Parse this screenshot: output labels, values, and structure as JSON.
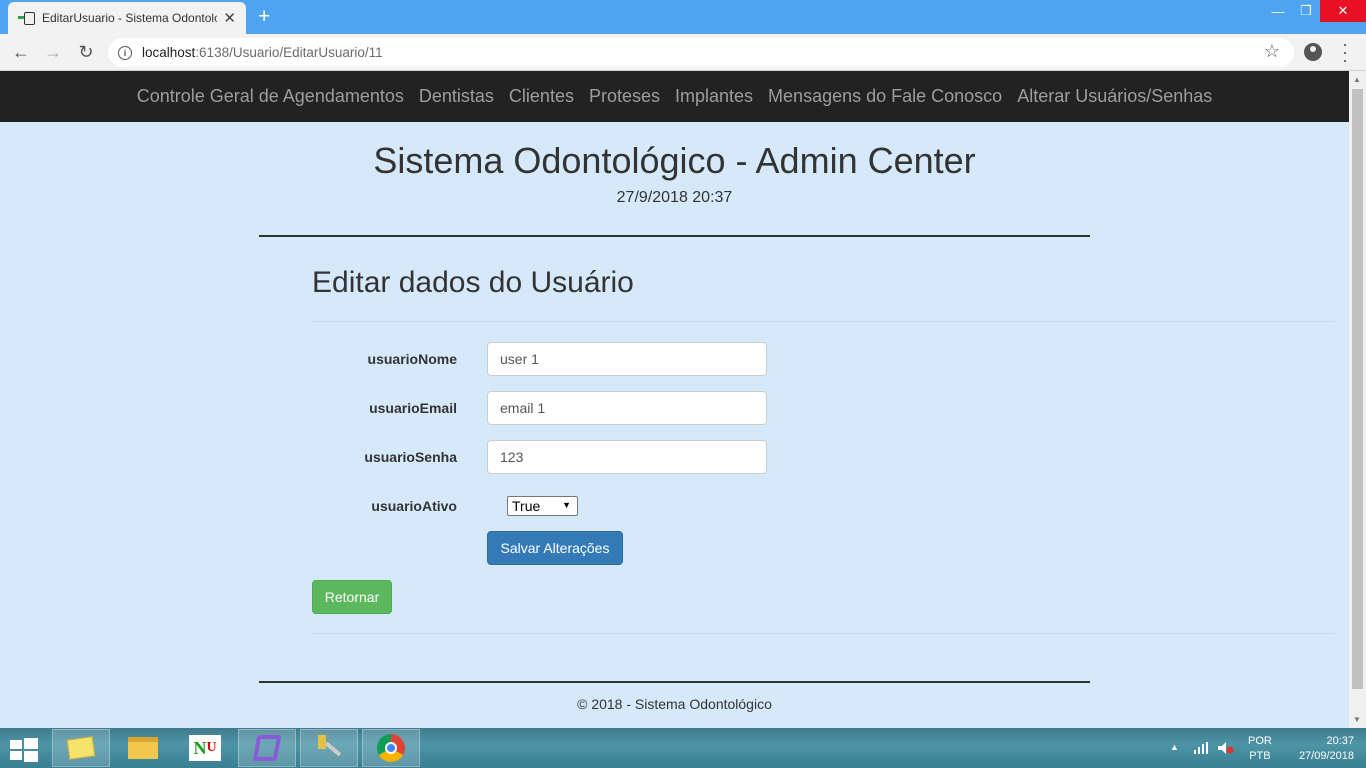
{
  "browser": {
    "tab_title": "EditarUsuario - Sistema Odontolc",
    "url_host": "localhost",
    "url_path": ":6138/Usuario/EditarUsuario/11"
  },
  "nav": {
    "items": [
      "Controle Geral de Agendamentos",
      "Dentistas",
      "Clientes",
      "Proteses",
      "Implantes",
      "Mensagens do Fale Conosco",
      "Alterar Usuários/Senhas"
    ]
  },
  "header": {
    "title": "Sistema Odontológico - Admin Center",
    "datetime": "27/9/2018 20:37"
  },
  "form": {
    "title": "Editar dados do Usuário",
    "fields": [
      {
        "label": "usuarioNome",
        "value": "user 1"
      },
      {
        "label": "usuarioEmail",
        "value": "email 1"
      },
      {
        "label": "usuarioSenha",
        "value": "123"
      }
    ],
    "ativo_label": "usuarioAtivo",
    "ativo_value": "True",
    "save_label": "Salvar Alterações",
    "back_label": "Retornar"
  },
  "footer": {
    "text": "© 2018 - Sistema Odontológico"
  },
  "taskbar": {
    "lang_top": "POR",
    "lang_bottom": "PTB",
    "time": "20:37",
    "date": "27/09/2018"
  },
  "colors": {
    "page_bg": "#d6e9fa",
    "navbar_bg": "#222222",
    "primary": "#337ab7",
    "success": "#5cb85c",
    "tabbar": "#4fa4f2"
  }
}
